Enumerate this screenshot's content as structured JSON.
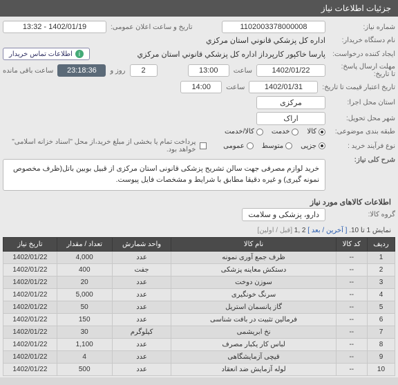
{
  "header": {
    "title": "جزئیات اطلاعات نیاز"
  },
  "labels": {
    "reqNo": "شماره نیاز:",
    "pubDate": "تاریخ و ساعت اعلان عمومی:",
    "buyerOrg": "نام دستگاه خریدار:",
    "requester": "ایجاد کننده درخواست:",
    "replyDeadline": "مهلت ارسال پاسخ:",
    "untilDate": "تا تاریخ:",
    "hourWord": "ساعت",
    "dayWord": "روز و",
    "remain": "ساعت باقی مانده",
    "validFrom": "تاریخ اعتبار قیمت تا تاریخ:",
    "execProvince": "استان محل اجرا:",
    "deliveryCity": "شهر محل تحویل:",
    "itemClass": "طبقه بندی موضوعی:",
    "buyProcess": "نوع فرآیند خرید :",
    "paymentNote": "پرداخت تمام یا بخشی از مبلغ خرید،از محل \"اسناد خزانه اسلامی\" خواهد بود.",
    "mainDesc": "شرح کلی نیاز:",
    "itemsTitle": "اطلاعات کالاهای مورد نیاز",
    "groupLabel": "گروه کالا:",
    "buyerInfoBadge": "اطلاعات تماس خریدار"
  },
  "fields": {
    "reqNo": "1102003378000008",
    "pubDate": "1402/01/19 - 13:32",
    "buyerOrg": "اداره کل پزشکي قانوني استان مرکزي",
    "requester": "پارسا خاکپور کارپرداز اداره کل پزشکي قانوني استان مرکزي",
    "replyDate": "1402/01/22",
    "replyTime": "13:00",
    "daysLeft": "2",
    "hoursLeft": "23:18:36",
    "validDate": "1402/01/31",
    "validTime": "14:00",
    "province": "مرکزی",
    "city": "اراک",
    "groupName": "دارو، پزشکی و سلامت"
  },
  "classOptions": {
    "goods": "کالا",
    "service": "خدمت",
    "both": "کالا/خدمت"
  },
  "processOptions": {
    "low": "جزیی",
    "mid": "متوسط",
    "open": "عمومی"
  },
  "description": "خرید لوازم مصرفی جهت سالن تشریح پزشکی قانونی استان مرکزی از قبیل بوبین باتل(ظرف مخصوص نمونه گیری) و غیره  دقیقا مطابق با شرایط و مشخصات فایل پیوست.",
  "pager": {
    "prefix": "نمایش 1 تا 10.",
    "last": "[ آخرین",
    "next": "/ بعد ]",
    "pages": "2 ,1",
    "first": "[قبل / اولین]"
  },
  "tableHeaders": {
    "row": "ردیف",
    "code": "کد کالا",
    "name": "نام کالا",
    "unit": "واحد شمارش",
    "qty": "تعداد / مقدار",
    "date": "تاریخ نیاز"
  },
  "rows": [
    {
      "n": "1",
      "code": "--",
      "name": "ظرف جمع آوری نمونه",
      "unit": "عدد",
      "qty": "4,000",
      "date": "1402/01/22"
    },
    {
      "n": "2",
      "code": "--",
      "name": "دستکش معاینه پزشکی",
      "unit": "جفت",
      "qty": "400",
      "date": "1402/01/22"
    },
    {
      "n": "3",
      "code": "--",
      "name": "سوزن دوخت",
      "unit": "عدد",
      "qty": "20",
      "date": "1402/01/22"
    },
    {
      "n": "4",
      "code": "--",
      "name": "سرنگ خونگیری",
      "unit": "عدد",
      "qty": "5,000",
      "date": "1402/01/22"
    },
    {
      "n": "5",
      "code": "--",
      "name": "گاز پانسمان استریل",
      "unit": "عدد",
      "qty": "50",
      "date": "1402/01/22"
    },
    {
      "n": "6",
      "code": "--",
      "name": "فرمالین تثبیت در بافت شناسی",
      "unit": "عدد",
      "qty": "150",
      "date": "1402/01/22"
    },
    {
      "n": "7",
      "code": "--",
      "name": "نخ ابریشمی",
      "unit": "کیلوگرم",
      "qty": "30",
      "date": "1402/01/22"
    },
    {
      "n": "8",
      "code": "--",
      "name": "لباس کار یکبار مصرف",
      "unit": "عدد",
      "qty": "1,100",
      "date": "1402/01/22"
    },
    {
      "n": "9",
      "code": "--",
      "name": "قیچی آزمایشگاهی",
      "unit": "عدد",
      "qty": "4",
      "date": "1402/01/22"
    },
    {
      "n": "10",
      "code": "--",
      "name": "لوله آزمایش ضد انعقاد",
      "unit": "عدد",
      "qty": "500",
      "date": "1402/01/22"
    }
  ]
}
